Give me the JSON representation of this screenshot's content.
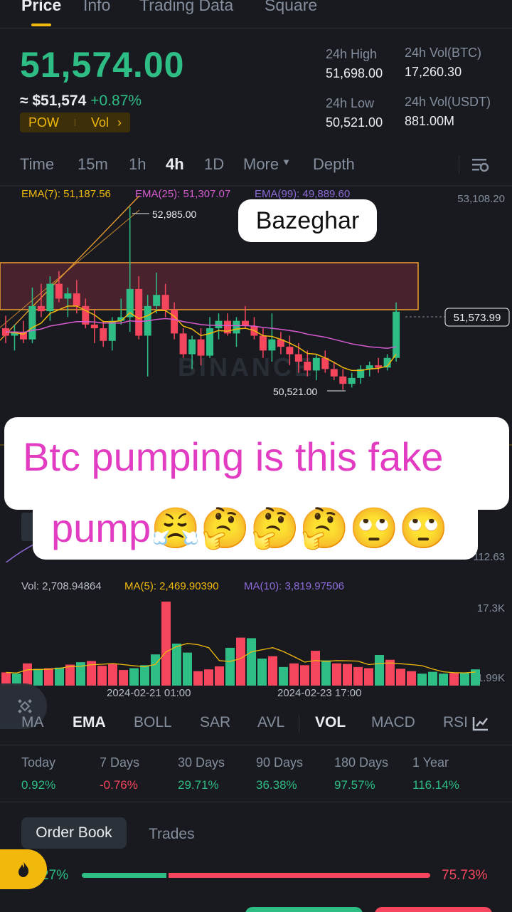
{
  "tabs": [
    {
      "label": "Price",
      "active": true
    },
    {
      "label": "Info",
      "active": false
    },
    {
      "label": "Trading Data",
      "active": false
    },
    {
      "label": "Square",
      "active": false
    }
  ],
  "ticker": {
    "price": "51,574.00",
    "usd_price": "≈ $51,574",
    "change": "+0.87%",
    "tag_1": "POW",
    "tag_2": "Vol",
    "tag_arrow": "›"
  },
  "stats": {
    "high_label": "24h High",
    "high_value": "51,698.00",
    "low_label": "24h Low",
    "low_value": "50,521.00",
    "vol_btc_label": "24h Vol(BTC)",
    "vol_btc_value": "17,260.30",
    "vol_usdt_label": "24h Vol(USDT)",
    "vol_usdt_value": "881.00M"
  },
  "intervals": [
    "Time",
    "15m",
    "1h",
    "4h",
    "1D",
    "More",
    "Depth"
  ],
  "active_interval": "4h",
  "ema": {
    "ema7": "EMA(7): 51,187.56",
    "ema25": "EMA(25): 51,307.07",
    "ema99": "EMA(99): 49,889.60"
  },
  "chart_labels": {
    "axis_top": "53,108.20",
    "high_marker": "52,985.00",
    "low_marker": "50,521.00",
    "current": "51,573.99",
    "axis_lower": "112.63",
    "watermark": "BINANCE"
  },
  "overlay": {
    "small_caption": "Bazeghar",
    "big_line1": "Btc pumping is this fake",
    "big_line2": "pump😤🤔🤔🤔🙄🙄"
  },
  "volume": {
    "vol": "Vol: 2,708.94864",
    "ma5": "MA(5): 2,469.90390",
    "ma10": "MA(10): 3,819.97506",
    "axis_top": "17.3K",
    "axis_bottom": "1.99K",
    "date1": "2024-02-21 01:00",
    "date2": "2024-02-23 17:00"
  },
  "indicators": [
    "MA",
    "EMA",
    "BOLL",
    "SAR",
    "AVL",
    "VOL",
    "MACD",
    "RSI"
  ],
  "performance": [
    {
      "label": "Today",
      "value": "0.92%",
      "positive": true
    },
    {
      "label": "7 Days",
      "value": "-0.76%",
      "positive": false
    },
    {
      "label": "30 Days",
      "value": "29.71%",
      "positive": true
    },
    {
      "label": "90 Days",
      "value": "36.38%",
      "positive": true
    },
    {
      "label": "180 Days",
      "value": "97.57%",
      "positive": true
    },
    {
      "label": "1 Year",
      "value": "116.14%",
      "positive": true
    }
  ],
  "orderbook": {
    "tab_1": "Order Book",
    "tab_2": "Trades",
    "bid_pct_text": "27%",
    "ask_pct_text": "75.73%",
    "bid_ratio": 0.2427,
    "ask_ratio": 0.7573
  },
  "colors": {
    "up": "#2ebd85",
    "down": "#f6465d",
    "accent": "#f0b90b",
    "ema7": "#f0b90b",
    "ema25": "#d75ad0",
    "ema99": "#8d6bd8"
  },
  "chart_data": {
    "type": "candlestick",
    "interval": "4h",
    "ylim": [
      50400,
      53108.2
    ],
    "candles": [
      {
        "o": 51350,
        "h": 51520,
        "l": 51150,
        "c": 51250
      },
      {
        "o": 51250,
        "h": 51400,
        "l": 51050,
        "c": 51300
      },
      {
        "o": 51300,
        "h": 51450,
        "l": 51150,
        "c": 51200
      },
      {
        "o": 51200,
        "h": 51900,
        "l": 51150,
        "c": 51650
      },
      {
        "o": 51650,
        "h": 51950,
        "l": 51500,
        "c": 51580
      },
      {
        "o": 51580,
        "h": 52050,
        "l": 51450,
        "c": 51950
      },
      {
        "o": 51950,
        "h": 52120,
        "l": 51700,
        "c": 51750
      },
      {
        "o": 51750,
        "h": 51900,
        "l": 51500,
        "c": 51820
      },
      {
        "o": 51820,
        "h": 52000,
        "l": 51550,
        "c": 51650
      },
      {
        "o": 51650,
        "h": 51750,
        "l": 51350,
        "c": 51400
      },
      {
        "o": 51400,
        "h": 51600,
        "l": 51150,
        "c": 51350
      },
      {
        "o": 51350,
        "h": 51450,
        "l": 51100,
        "c": 51180
      },
      {
        "o": 51180,
        "h": 51500,
        "l": 51050,
        "c": 51450
      },
      {
        "o": 51450,
        "h": 51750,
        "l": 51400,
        "c": 51500
      },
      {
        "o": 51500,
        "h": 52985,
        "l": 51300,
        "c": 51880
      },
      {
        "o": 51880,
        "h": 52050,
        "l": 51200,
        "c": 51250
      },
      {
        "o": 51250,
        "h": 51800,
        "l": 50700,
        "c": 51650
      },
      {
        "o": 51650,
        "h": 52100,
        "l": 51550,
        "c": 51800
      },
      {
        "o": 51800,
        "h": 51950,
        "l": 51500,
        "c": 51600
      },
      {
        "o": 51600,
        "h": 51700,
        "l": 51200,
        "c": 51280
      },
      {
        "o": 51280,
        "h": 51350,
        "l": 50950,
        "c": 51000
      },
      {
        "o": 51000,
        "h": 51250,
        "l": 50800,
        "c": 51200
      },
      {
        "o": 51200,
        "h": 51350,
        "l": 50850,
        "c": 50980
      },
      {
        "o": 50980,
        "h": 51500,
        "l": 50950,
        "c": 51350
      },
      {
        "o": 51350,
        "h": 51550,
        "l": 51200,
        "c": 51450
      },
      {
        "o": 51450,
        "h": 51550,
        "l": 51250,
        "c": 51280
      },
      {
        "o": 51280,
        "h": 51500,
        "l": 51100,
        "c": 51450
      },
      {
        "o": 51450,
        "h": 51650,
        "l": 51350,
        "c": 51380
      },
      {
        "o": 51380,
        "h": 51500,
        "l": 51200,
        "c": 51250
      },
      {
        "o": 51250,
        "h": 51350,
        "l": 50950,
        "c": 51050
      },
      {
        "o": 51050,
        "h": 51550,
        "l": 50900,
        "c": 51200
      },
      {
        "o": 51200,
        "h": 51300,
        "l": 51000,
        "c": 51100
      },
      {
        "o": 51100,
        "h": 51250,
        "l": 50850,
        "c": 51000
      },
      {
        "o": 51000,
        "h": 51150,
        "l": 50750,
        "c": 50900
      },
      {
        "o": 50900,
        "h": 51050,
        "l": 50700,
        "c": 50780
      },
      {
        "o": 50780,
        "h": 51000,
        "l": 50650,
        "c": 50950
      },
      {
        "o": 50950,
        "h": 51050,
        "l": 50750,
        "c": 50800
      },
      {
        "o": 50800,
        "h": 50900,
        "l": 50650,
        "c": 50700
      },
      {
        "o": 50700,
        "h": 50800,
        "l": 50521,
        "c": 50600
      },
      {
        "o": 50600,
        "h": 50750,
        "l": 50550,
        "c": 50680
      },
      {
        "o": 50680,
        "h": 50850,
        "l": 50600,
        "c": 50800
      },
      {
        "o": 50800,
        "h": 50900,
        "l": 50700,
        "c": 50850
      },
      {
        "o": 50850,
        "h": 50950,
        "l": 50750,
        "c": 50820
      },
      {
        "o": 50820,
        "h": 51000,
        "l": 50780,
        "c": 50950
      },
      {
        "o": 50950,
        "h": 51698,
        "l": 50900,
        "c": 51574
      }
    ],
    "volumes": [
      2200,
      2000,
      3700,
      2800,
      2900,
      3000,
      3500,
      3900,
      4100,
      3300,
      3600,
      2600,
      2900,
      3400,
      5200,
      14000,
      7000,
      5500,
      2400,
      2700,
      3200,
      6300,
      8000,
      7900,
      4500,
      4900,
      3100,
      3700,
      3400,
      5800,
      4200,
      3700,
      3600,
      3100,
      2900,
      5100,
      4300,
      2800,
      2400,
      1990,
      2300,
      2000,
      2100,
      2200,
      2709
    ],
    "ema7": [
      51300,
      51290,
      51270,
      51360,
      51420,
      51550,
      51600,
      51650,
      51650,
      51590,
      51530,
      51440,
      51440,
      51450,
      51560,
      51480,
      51520,
      51590,
      51590,
      51510,
      51380,
      51340,
      51250,
      51280,
      51320,
      51310,
      51340,
      51350,
      51320,
      51250,
      51240,
      51200,
      51150,
      51090,
      51010,
      51000,
      50950,
      50890,
      50820,
      50780,
      50780,
      50800,
      50810,
      50840,
      51000
    ],
    "ema25": [
      51300,
      51300,
      51295,
      51320,
      51340,
      51380,
      51400,
      51420,
      51440,
      51440,
      51435,
      51420,
      51420,
      51420,
      51450,
      51440,
      51450,
      51470,
      51480,
      51470,
      51440,
      51420,
      51400,
      51390,
      51390,
      51385,
      51385,
      51385,
      51380,
      51360,
      51350,
      51335,
      51320,
      51300,
      51270,
      51250,
      51230,
      51200,
      51170,
      51140,
      51120,
      51100,
      51090,
      51080,
      51100
    ]
  }
}
